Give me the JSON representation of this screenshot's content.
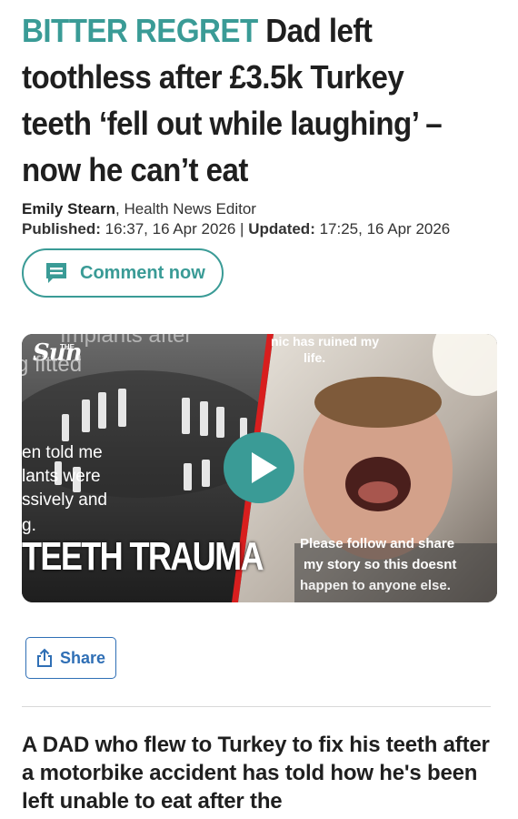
{
  "colors": {
    "accent": "#3a9b96",
    "link_blue": "#2f6fb5"
  },
  "headline": {
    "kicker": "BITTER REGRET",
    "title": "Dad left toothless after £3.5k Turkey teeth ‘fell out while laughing’ – now he can’t eat"
  },
  "byline": {
    "author": "Emily Stearn",
    "role": ", Health News Editor",
    "published_label": "Published:",
    "published_value": " 16:37, 16 Apr 2026",
    "separator": " | ",
    "updated_label": "Updated:",
    "updated_value": " 17:25, 16 Apr 2026"
  },
  "comment_button": {
    "label": "Comment now",
    "icon": "comment-icon"
  },
  "video": {
    "logo_small": "THE",
    "logo": "Sun",
    "overlay_left": [
      "Implants after",
      "g fitted",
      "en told me",
      "lants were",
      "ssively and",
      "g."
    ],
    "overlay_right_top": [
      "nic has ruined my",
      "life."
    ],
    "overlay_right_bottom": [
      "Please follow and share",
      "my story so this doesnt",
      "happen to anyone else."
    ],
    "title": "TEETH TRAUMA",
    "play_icon": "play-icon"
  },
  "share_button": {
    "label": "Share",
    "icon": "share-icon"
  },
  "standfirst": "A DAD who flew to Turkey to fix his teeth after a motorbike accident has told how he's been left unable to eat after the"
}
